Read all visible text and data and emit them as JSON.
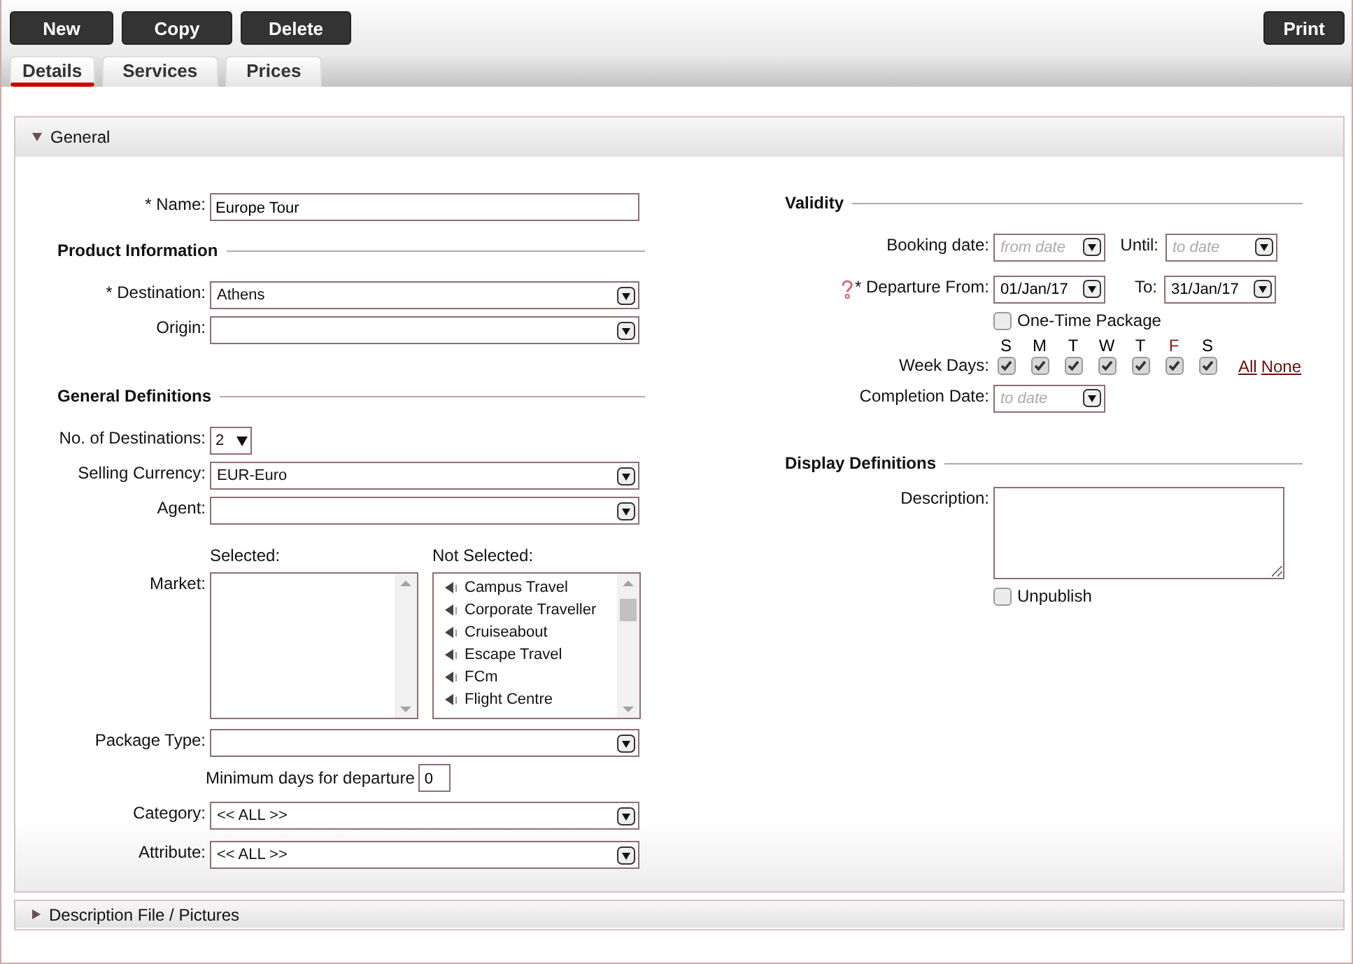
{
  "toolbar": {
    "buttons": [
      {
        "label": "New"
      },
      {
        "label": "Copy"
      },
      {
        "label": "Delete"
      }
    ],
    "print": {
      "label": "Print"
    }
  },
  "tabs": [
    {
      "label": "Details",
      "selected": true
    },
    {
      "label": "Services",
      "selected": false
    },
    {
      "label": "Prices",
      "selected": false
    }
  ],
  "panels": [
    {
      "title": "General",
      "expanded": true
    },
    {
      "title": "Description File / Pictures",
      "expanded": false
    }
  ],
  "general": {
    "name": {
      "label": "* Name:",
      "value": "Europe Tour"
    },
    "product_information": {
      "heading": "Product Information",
      "destination": {
        "label": "* Destination:",
        "value": "Athens"
      },
      "origin": {
        "label": "Origin:"
      }
    },
    "general_definitions": {
      "heading": "General Definitions",
      "destinations_count": {
        "label": "No. of Destinations:",
        "value": "2"
      },
      "selling_currency": {
        "label": "Selling Currency:",
        "value": "EUR-Euro"
      },
      "agent": {
        "label": "Agent:"
      },
      "market": {
        "label": "Market:",
        "selected_heading": "Selected:",
        "not_selected_heading": "Not Selected:",
        "not_selected_items": [
          "Campus Travel",
          "Corporate Traveller",
          "Cruiseabout",
          "Escape Travel",
          "FCm",
          "Flight Centre"
        ]
      },
      "package_type": {
        "label": "Package Type:"
      },
      "minimum_days": {
        "label": "Minimum days for departure",
        "value": "0"
      },
      "category": {
        "label": "Category:",
        "value": "<< ALL >>"
      },
      "attribute": {
        "label": "Attribute:",
        "value": "<< ALL >>"
      }
    },
    "validity": {
      "heading": "Validity",
      "booking_date": {
        "label": "Booking date:",
        "placeholder": "from date"
      },
      "until": {
        "label": "Until:",
        "placeholder": "to date"
      },
      "departure_from": {
        "label": "* Departure From:",
        "value": "01/Jan/17"
      },
      "to": {
        "label": "To:",
        "value": "31/Jan/17"
      },
      "one_time_package": {
        "label": "One-Time Package",
        "checked": false
      },
      "week_days": {
        "label": "Week Days:",
        "days": [
          {
            "letter": "S",
            "checked": true,
            "color": "#000000"
          },
          {
            "letter": "M",
            "checked": true,
            "color": "#000000"
          },
          {
            "letter": "T",
            "checked": true,
            "color": "#000000"
          },
          {
            "letter": "W",
            "checked": true,
            "color": "#000000"
          },
          {
            "letter": "T",
            "checked": true,
            "color": "#000000"
          },
          {
            "letter": "F",
            "checked": true,
            "color": "#8b1a1a"
          },
          {
            "letter": "S",
            "checked": true,
            "color": "#000000"
          }
        ],
        "links": [
          "All",
          "None"
        ]
      },
      "completion_date": {
        "label": "Completion Date:",
        "placeholder": "to date"
      }
    },
    "display_definitions": {
      "heading": "Display Definitions",
      "description": {
        "label": "Description:"
      },
      "unpublish": {
        "label": "Unpublish",
        "checked": false
      }
    }
  }
}
